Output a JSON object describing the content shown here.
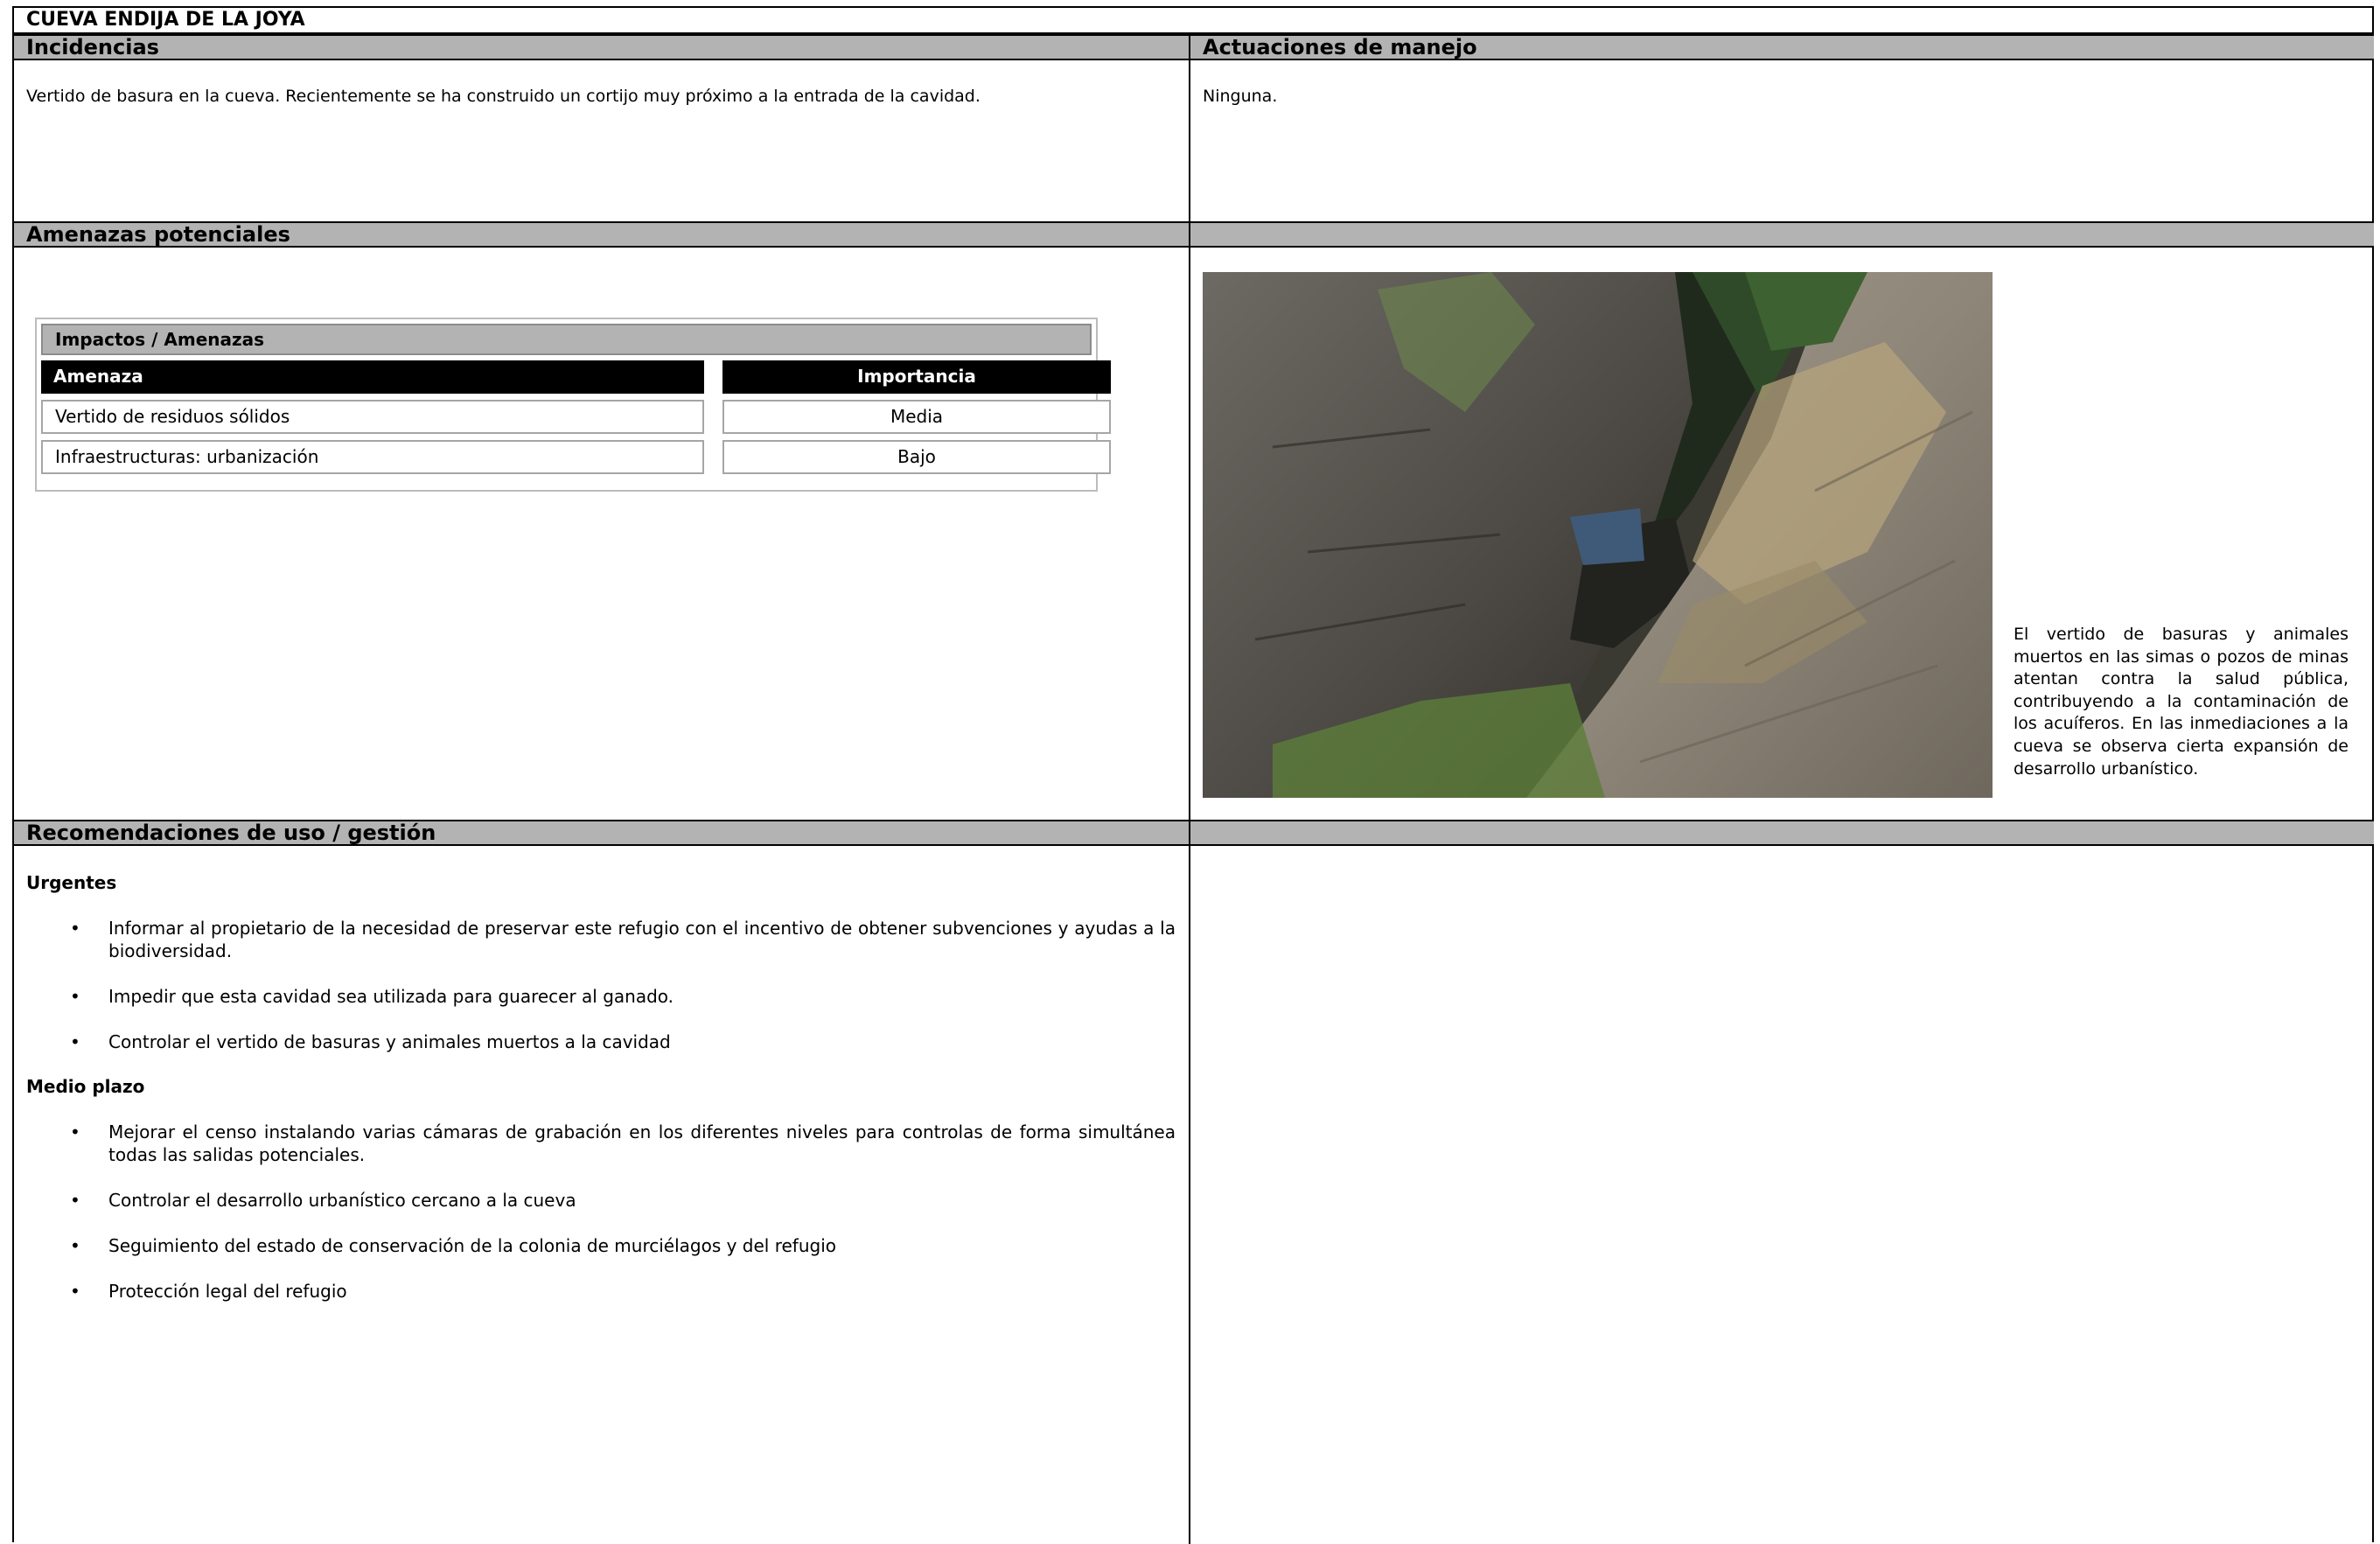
{
  "title": "CUEVA ENDIJA DE LA JOYA",
  "incidencias": {
    "header": "Incidencias",
    "text": "Vertido de basura en la cueva. Recientemente se ha construido un cortijo muy próximo a la entrada de la cavidad."
  },
  "actuaciones": {
    "header": "Actuaciones de manejo",
    "text": "Ninguna."
  },
  "amenazas": {
    "header": "Amenazas potenciales",
    "table": {
      "title": "Impactos / Amenazas",
      "col_amenaza": "Amenaza",
      "col_importancia": "Importancia",
      "rows": [
        {
          "amenaza": "Vertido de residuos sólidos",
          "importancia": "Media"
        },
        {
          "amenaza": "Infraestructuras: urbanización",
          "importancia": "Bajo"
        }
      ]
    },
    "photo_caption": "El vertido de basuras y animales muertos en las simas o pozos de minas atentan contra la salud pública, contribuyendo a la contaminación de los acuíferos. En las inmediaciones a la cueva se observa cierta expansión de desarrollo urbanístico."
  },
  "recomendaciones": {
    "header": "Recomendaciones de uso / gestión",
    "urgentes_label": "Urgentes",
    "urgentes": [
      "Informar al propietario de la necesidad de preservar este refugio con el incentivo de obtener subvenciones y ayudas a la biodiversidad.",
      "Impedir que esta cavidad sea utilizada para guarecer al ganado.",
      "Controlar el vertido de basuras y animales muertos a la cavidad"
    ],
    "medio_label": "Medio plazo",
    "medio": [
      "Mejorar el censo instalando varias cámaras de grabación en los diferentes niveles para controlas de forma simultánea todas las salidas potenciales.",
      "Controlar el desarrollo urbanístico cercano a la cueva",
      "Seguimiento del estado de conservación de la colonia de murciélagos y del refugio",
      "Protección legal del refugio"
    ],
    "bullet": "•"
  },
  "colors": {
    "header_bg": "#b3b3b3",
    "table_header_bg": "#000000",
    "border": "#000000"
  }
}
